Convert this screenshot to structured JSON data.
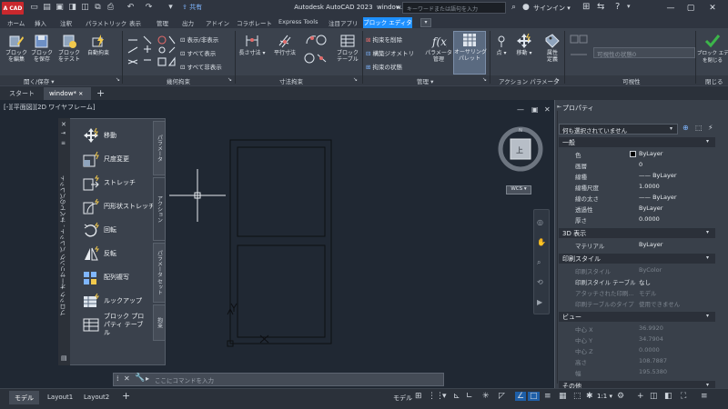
{
  "app": {
    "logo": "A CAD",
    "title": "Autodesk AutoCAD 2023",
    "filename": "window.dwg",
    "share_label": "共有",
    "search_placeholder": "キーワードまたは語句を入力",
    "signin_label": "サインイン"
  },
  "ribbon_tabs": [
    "ホーム",
    "挿入",
    "注釈",
    "パラメトリック",
    "表示",
    "管理",
    "出力",
    "アドイン",
    "コラボレート",
    "Express Tools",
    "注目アプリ"
  ],
  "active_tab": "ブロック エディタ",
  "ribbon": {
    "open_save": {
      "edit_block": "ブロック\nを編集",
      "save_block": "ブロック\nを保存",
      "test_block": "ブロック\nをテスト",
      "auto_constraint": "自動拘束",
      "footer": "開く/保存"
    },
    "geometric": {
      "show_hide": "表示/非表示",
      "show_all": "すべて表示",
      "hide_all": "すべて非表示",
      "footer": "幾何拘束"
    },
    "dimensional": {
      "linear": "長さ寸法",
      "aligned": "平行寸法",
      "block_table": "ブロック\nテーブル",
      "footer": "寸法拘束"
    },
    "manage": {
      "delete_constraint": "拘束を削除",
      "construction": "構築ジオメトリ",
      "constraint_state": "拘束の状態",
      "param_manager": "パラメータ\n管理",
      "authoring_palette": "オーサリング\nパレット",
      "footer": "管理"
    },
    "action_param": {
      "point": "点",
      "move": "移動",
      "attribute_def": "属性\n定義",
      "footer": "アクション パラメータ"
    },
    "visibility": {
      "visibility_state": "可視性の状態0",
      "footer": "可視性"
    },
    "close": {
      "close_editor": "ブロック エディタ\nを閉じる",
      "footer": "閉じる"
    }
  },
  "doc_tabs": {
    "start": "スタート",
    "active": "window*"
  },
  "viewport_label": "[-][平面図][2D ワイヤフレーム]",
  "palette": {
    "title": "ブロック オーサリング パレット - すべてのパレット",
    "items": [
      {
        "label": "移動",
        "icon": "move-action-icon"
      },
      {
        "label": "尺度変更",
        "icon": "scale-action-icon"
      },
      {
        "label": "ストレッチ",
        "icon": "stretch-action-icon"
      },
      {
        "label": "円形状ストレッチ",
        "icon": "polar-stretch-action-icon"
      },
      {
        "label": "回転",
        "icon": "rotate-action-icon"
      },
      {
        "label": "反転",
        "icon": "flip-action-icon"
      },
      {
        "label": "配列複写",
        "icon": "array-action-icon"
      },
      {
        "label": "ルックアップ",
        "icon": "lookup-action-icon"
      },
      {
        "label": "ブロック プロパティ テーブル",
        "icon": "block-property-table-icon"
      }
    ],
    "side_tabs": [
      "パラメータ",
      "アクション",
      "パラメータ セット",
      "拘束"
    ]
  },
  "viewcube": {
    "face": "上",
    "wcs": "WCS"
  },
  "command_placeholder": "ここにコマンドを入力",
  "properties": {
    "title": "プロパティ",
    "selection": "何も選択されていません",
    "sections": [
      {
        "name": "一般",
        "rows": [
          {
            "label": "色",
            "value": "ByLayer"
          },
          {
            "label": "画層",
            "value": "0"
          },
          {
            "label": "線種",
            "value": "—— ByLayer"
          },
          {
            "label": "線種尺度",
            "value": "1.0000"
          },
          {
            "label": "線の太さ",
            "value": "—— ByLayer"
          },
          {
            "label": "透過性",
            "value": "ByLayer"
          },
          {
            "label": "厚さ",
            "value": "0.0000"
          }
        ]
      },
      {
        "name": "3D 表示",
        "rows": [
          {
            "label": "マテリアル",
            "value": "ByLayer"
          }
        ]
      },
      {
        "name": "印刷スタイル",
        "rows": [
          {
            "label": "印刷スタイル",
            "value": "ByColor",
            "dim": true
          },
          {
            "label": "印刷スタイル テーブル",
            "value": "なし"
          },
          {
            "label": "アタッチされた印刷...",
            "value": "モデル",
            "dim": true
          },
          {
            "label": "印刷テーブルのタイプ",
            "value": "使用できません",
            "dim": true
          }
        ]
      },
      {
        "name": "ビュー",
        "rows": [
          {
            "label": "中心 X",
            "value": "36.9920",
            "dim": true
          },
          {
            "label": "中心 Y",
            "value": "34.7904",
            "dim": true
          },
          {
            "label": "中心 Z",
            "value": "0.0000",
            "dim": true
          },
          {
            "label": "高さ",
            "value": "108.7887",
            "dim": true
          },
          {
            "label": "幅",
            "value": "195.5380",
            "dim": true
          }
        ]
      },
      {
        "name": "その他",
        "rows": []
      }
    ]
  },
  "status": {
    "tabs": [
      "モデル",
      "Layout1",
      "Layout2"
    ],
    "model_label": "モデル",
    "scale": "1:1"
  },
  "colors": {
    "accent": "#1e90ff",
    "close_green": "#3cb54a"
  }
}
